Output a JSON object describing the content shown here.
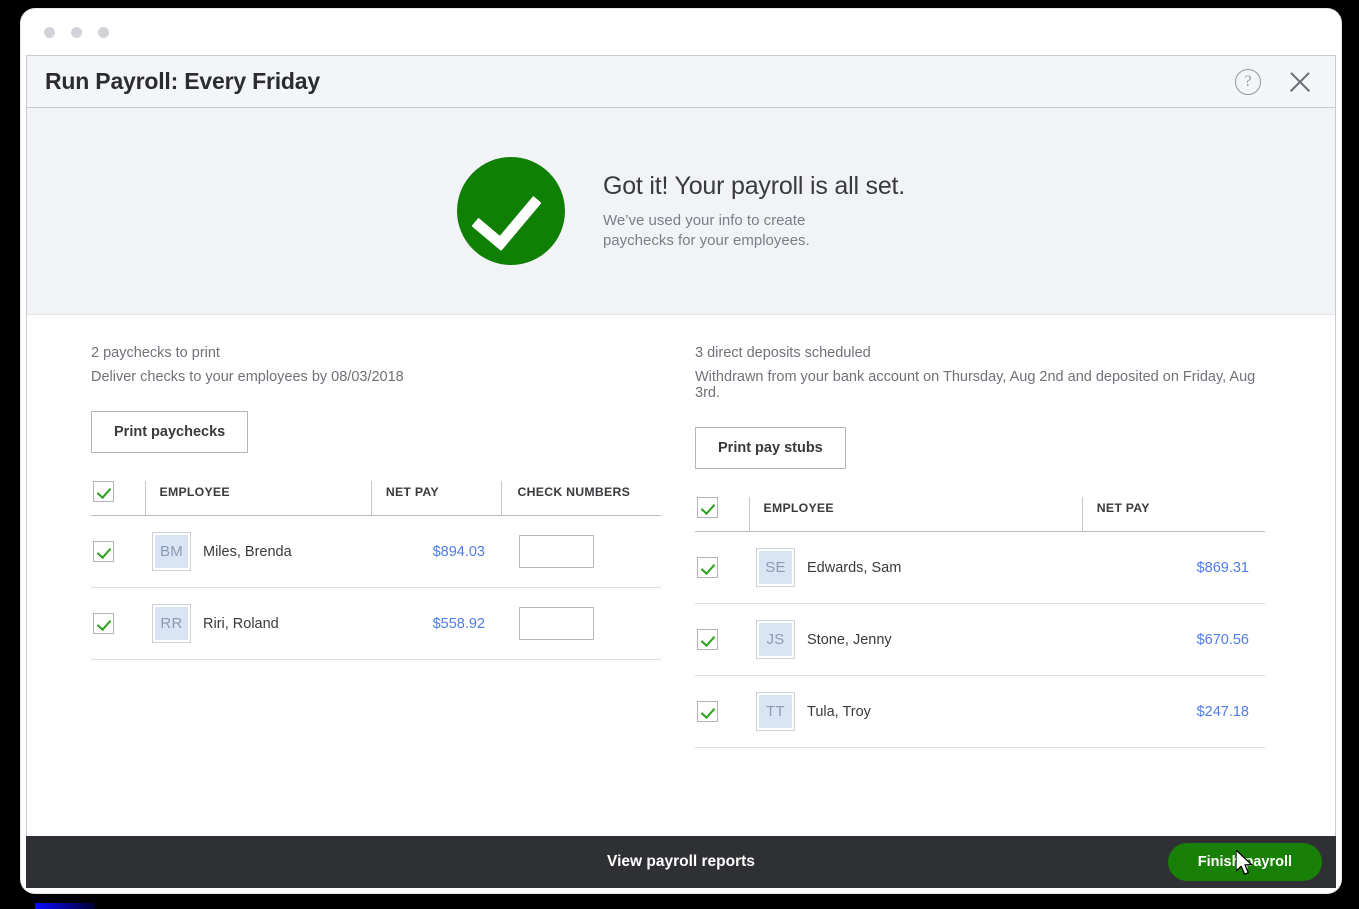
{
  "window": {
    "traffic_dots": [
      "dot-1",
      "dot-2",
      "dot-3"
    ]
  },
  "modal": {
    "title": "Run Payroll: Every Friday",
    "help_icon": "help-icon",
    "help_glyph": "?",
    "close_icon": "close-icon"
  },
  "hero": {
    "icon": "check-circle-icon",
    "title": "Got it! Your payroll is all set.",
    "subtitle_line1": "We’ve used your info to create",
    "subtitle_line2": "paychecks for your employees."
  },
  "left_column": {
    "count_label": "2 paychecks to print",
    "note": "Deliver checks to your employees by 08/03/2018",
    "button_label": "Print paychecks",
    "headers": {
      "select_all": "select-all-checkbox",
      "employee": "EMPLOYEE",
      "net_pay": "NET PAY",
      "check_numbers": "CHECK NUMBERS"
    },
    "rows": [
      {
        "selected": true,
        "initials": "BM",
        "name": "Miles, Brenda",
        "net_pay": "$894.03",
        "check_number": "",
        "check_number_placeholder": ""
      },
      {
        "selected": true,
        "initials": "RR",
        "name": "Riri, Roland",
        "net_pay": "$558.92",
        "check_number": "",
        "check_number_placeholder": ""
      }
    ]
  },
  "right_column": {
    "count_label": "3 direct deposits scheduled",
    "note": "Withdrawn from your bank account on Thursday, Aug 2nd and deposited on Friday, Aug 3rd.",
    "button_label": "Print pay stubs",
    "headers": {
      "select_all": "select-all-checkbox",
      "employee": "EMPLOYEE",
      "net_pay": "NET PAY"
    },
    "rows": [
      {
        "selected": true,
        "initials": "SE",
        "name": "Edwards, Sam",
        "net_pay": "$869.31"
      },
      {
        "selected": true,
        "initials": "JS",
        "name": "Stone, Jenny",
        "net_pay": "$670.56"
      },
      {
        "selected": true,
        "initials": "TT",
        "name": "Tula, Troy",
        "net_pay": "$247.18"
      }
    ]
  },
  "footer": {
    "reports_link": "View payroll reports",
    "finish_button": "Finish payroll"
  },
  "colors": {
    "accent_green": "#2ca01c",
    "hero_green": "#0f8004",
    "primary_button_green": "#198007",
    "net_pay_blue": "#4f7ce8",
    "avatar_bg": "#d9e5f5",
    "footer_bg": "#2e3033",
    "hero_bg": "#f2f3f7",
    "header_bg": "#f4f5f8"
  }
}
